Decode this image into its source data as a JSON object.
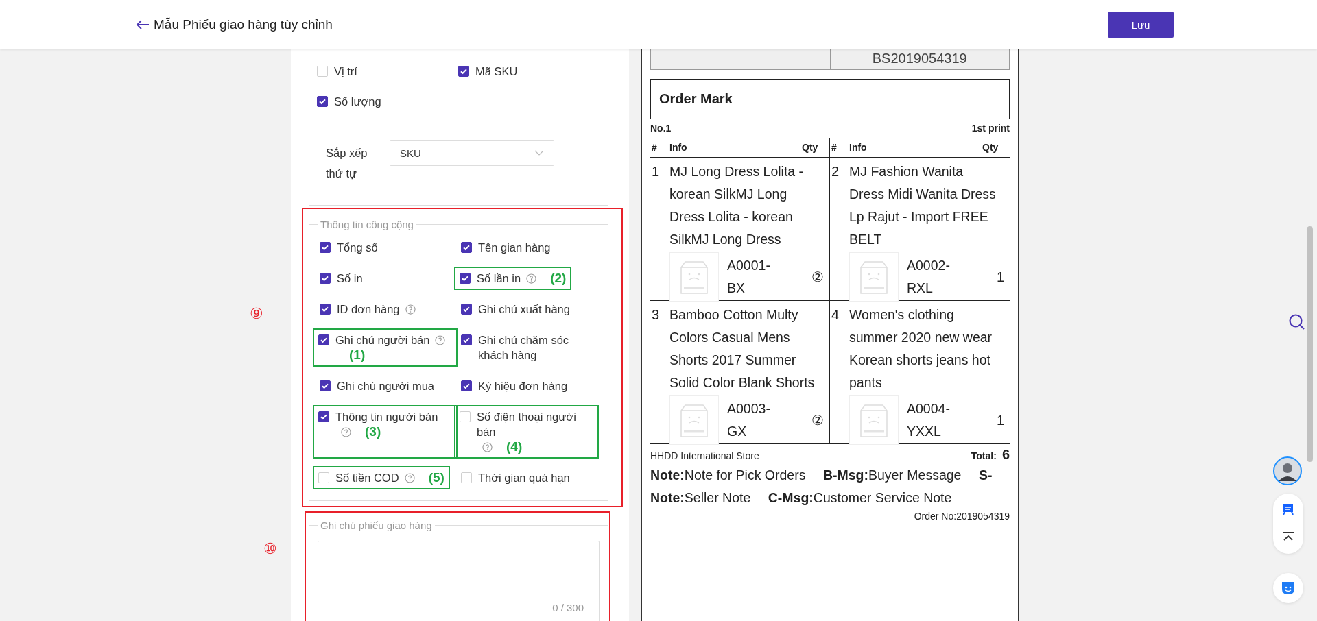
{
  "header": {
    "title": "Mẫu Phiếu giao hàng tùy chỉnh",
    "save_button": "Lưu"
  },
  "item_fields": {
    "options": [
      {
        "label": "Vị trí",
        "checked": false
      },
      {
        "label": "Mã SKU",
        "checked": true
      },
      {
        "label": "Số lượng",
        "checked": true
      }
    ],
    "sort": {
      "label": "Sắp xếp thứ tự",
      "value": "SKU"
    }
  },
  "public_info": {
    "marker": "⑨",
    "title": "Thông tin công cộng",
    "options": [
      {
        "label": "Tổng số",
        "checked": true
      },
      {
        "label": "Tên gian hàng",
        "checked": true
      },
      {
        "label": "Số in",
        "checked": true
      },
      {
        "label": "Số lần in",
        "checked": true,
        "help": true,
        "callout": "(2)"
      },
      {
        "label": "ID đơn hàng",
        "checked": true,
        "help": true
      },
      {
        "label": "Ghi chú xuất hàng",
        "checked": true
      },
      {
        "label": "Ghi chú người bán",
        "checked": true,
        "help": true,
        "callout": "(1)"
      },
      {
        "label": "Ghi chú chăm sóc khách hàng",
        "checked": true
      },
      {
        "label": "Ghi chú người mua",
        "checked": true
      },
      {
        "label": "Ký hiệu đơn hàng",
        "checked": true
      },
      {
        "label": "Thông tin người bán",
        "checked": true,
        "help": true,
        "callout": "(3)"
      },
      {
        "label": "Số điện thoại người bán",
        "checked": false,
        "help": true,
        "callout": "(4)"
      },
      {
        "label": "Số tiền COD",
        "checked": false,
        "help": true,
        "callout": "(5)"
      },
      {
        "label": "Thời gian quá hạn",
        "checked": false
      }
    ]
  },
  "delivery_note": {
    "marker": "⑩",
    "title": "Ghi chú phiếu giao hàng",
    "counter": "0 / 300"
  },
  "preview": {
    "top_cells": [
      "BS2019054319"
    ],
    "order_mark": "Order Mark",
    "number": "No.1",
    "print_count": "1st print",
    "columns": [
      [
        "#",
        "Info",
        "Qty"
      ],
      [
        "#",
        "Info",
        "Qty"
      ]
    ],
    "items": [
      {
        "index": "1",
        "name": "MJ Long Dress Lolita - korean SilkMJ Long Dress Lolita - korean SilkMJ Long Dress",
        "sku": "A0001-BX",
        "qty": "②"
      },
      {
        "index": "2",
        "name": "MJ Fashion Wanita Dress Midi Wanita Dress Lp Rajut - Import FREE BELT",
        "sku": "A0002-RXL",
        "qty": "1"
      },
      {
        "index": "3",
        "name": "Bamboo Cotton Multy Colors Casual Mens Shorts 2017 Summer Solid Color Blank Shorts",
        "sku": "A0003-GX",
        "qty": "②"
      },
      {
        "index": "4",
        "name": "Women's clothing summer 2020 new wear Korean shorts jeans hot pants",
        "sku": "A0004-YXXL",
        "qty": "1"
      }
    ],
    "store": "HHDD International Store",
    "total_label": "Total:",
    "total": "6",
    "notes": [
      "**Note:**Note for Pick Orders",
      "**B-Msg:**Buyer Message",
      "**S-Note:**Seller Note",
      "**C-Msg:**Customer Service Note"
    ],
    "order_no": "Order No:2019054319"
  }
}
